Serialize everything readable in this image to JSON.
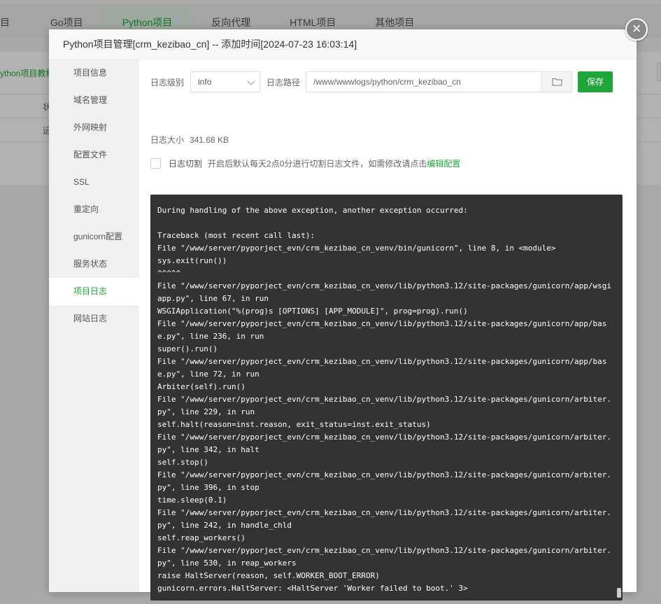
{
  "background": {
    "tabs": [
      {
        "label": "目",
        "active": false
      },
      {
        "label": "Go项目",
        "active": false
      },
      {
        "label": "Python项目",
        "active": true
      },
      {
        "label": "反向代理",
        "active": false
      },
      {
        "label": "HTML项目",
        "active": false
      },
      {
        "label": "其他项目",
        "active": false
      }
    ],
    "partial_link": "ython项目教程",
    "cell1": "状",
    "cell2": "运"
  },
  "modal": {
    "title": "Python项目管理[crm_kezibao_cn] -- 添加时间[2024-07-23 16:03:14]",
    "close_symbol": "×",
    "sidebar": [
      {
        "label": "项目信息",
        "active": false
      },
      {
        "label": "域名管理",
        "active": false
      },
      {
        "label": "外网映射",
        "active": false
      },
      {
        "label": "配置文件",
        "active": false
      },
      {
        "label": "SSL",
        "active": false
      },
      {
        "label": "重定向",
        "active": false
      },
      {
        "label": "gunicorn配置",
        "active": false
      },
      {
        "label": "服务状态",
        "active": false
      },
      {
        "label": "项目日志",
        "active": true
      },
      {
        "label": "网站日志",
        "active": false
      }
    ],
    "log_level_label": "日志级别",
    "log_level_value": "info",
    "log_path_label": "日志路径",
    "log_path_value": "/www/wwwlogs/python/crm_kezibao_cn",
    "save_label": "保存",
    "log_size_label": "日志大小",
    "log_size_value": "341.68 KB",
    "cut_label": "日志切割",
    "cut_desc": "开启后默认每天2点0分进行切割日志文件，如需修改请点击",
    "cut_link": "编辑配置",
    "log_content": "During handling of the above exception, another exception occurred:\n\nTraceback (most recent call last):\nFile \"/www/server/pyporject_evn/crm_kezibao_cn_venv/bin/gunicorn\", line 8, in <module>\nsys.exit(run())\n^^^^^\nFile \"/www/server/pyporject_evn/crm_kezibao_cn_venv/lib/python3.12/site-packages/gunicorn/app/wsgi\napp.py\", line 67, in run\nWSGIApplication(\"%(prog)s [OPTIONS] [APP_MODULE]\", prog=prog).run()\nFile \"/www/server/pyporject_evn/crm_kezibao_cn_venv/lib/python3.12/site-packages/gunicorn/app/bas\ne.py\", line 236, in run\nsuper().run()\nFile \"/www/server/pyporject_evn/crm_kezibao_cn_venv/lib/python3.12/site-packages/gunicorn/app/bas\ne.py\", line 72, in run\nArbiter(self).run()\nFile \"/www/server/pyporject_evn/crm_kezibao_cn_venv/lib/python3.12/site-packages/gunicorn/arbiter.\npy\", line 229, in run\nself.halt(reason=inst.reason, exit_status=inst.exit_status)\nFile \"/www/server/pyporject_evn/crm_kezibao_cn_venv/lib/python3.12/site-packages/gunicorn/arbiter.\npy\", line 342, in halt\nself.stop()\nFile \"/www/server/pyporject_evn/crm_kezibao_cn_venv/lib/python3.12/site-packages/gunicorn/arbiter.\npy\", line 396, in stop\ntime.sleep(0.1)\nFile \"/www/server/pyporject_evn/crm_kezibao_cn_venv/lib/python3.12/site-packages/gunicorn/arbiter.\npy\", line 242, in handle_chld\nself.reap_workers()\nFile \"/www/server/pyporject_evn/crm_kezibao_cn_venv/lib/python3.12/site-packages/gunicorn/arbiter.\npy\", line 530, in reap_workers\nraise HaltServer(reason, self.WORKER_BOOT_ERROR)\ngunicorn.errors.HaltServer: <HaltServer 'Worker failed to boot.' 3>"
  },
  "colors": {
    "accent": "#20a53a",
    "log_bg": "#333333",
    "sidebar_bg": "#f0f0f0"
  }
}
